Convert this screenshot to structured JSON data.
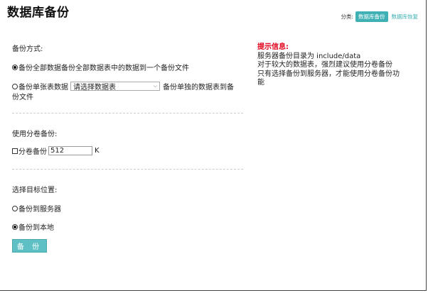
{
  "header": {
    "title": "数据库备份",
    "category_label": "分类:",
    "tabs": [
      {
        "label": "数据库备份",
        "active": true
      },
      {
        "label": "数据库恢复",
        "active": false
      }
    ]
  },
  "form": {
    "method_label": "备份方式:",
    "option_all": "备份全部数据备份全部数据表中的数据到一个备份文件",
    "option_single_prefix": "备份单张表数据",
    "table_select": "请选择数据表",
    "option_single_suffix_1": "备份单独的数据表到备",
    "option_single_suffix_2": "份文件",
    "volume_label": "使用分卷备份:",
    "volume_check_label": "分卷备份",
    "volume_size": "512",
    "volume_unit": "K",
    "target_label": "选择目标位置:",
    "target_server": "备份到服务器",
    "target_local": "备份到本地",
    "submit": "备 份"
  },
  "hint": {
    "title": "提示信息:",
    "lines": [
      "服务器备份目录为 include/data",
      "对于较大的数据表，强烈建议使用分卷备份",
      "只有选择备份到服务器，才能使用分卷备份功",
      "能"
    ]
  },
  "colors": {
    "accent": "#3fb1b5",
    "button": "#5ec0c4",
    "hint_title": "#e0001a"
  }
}
